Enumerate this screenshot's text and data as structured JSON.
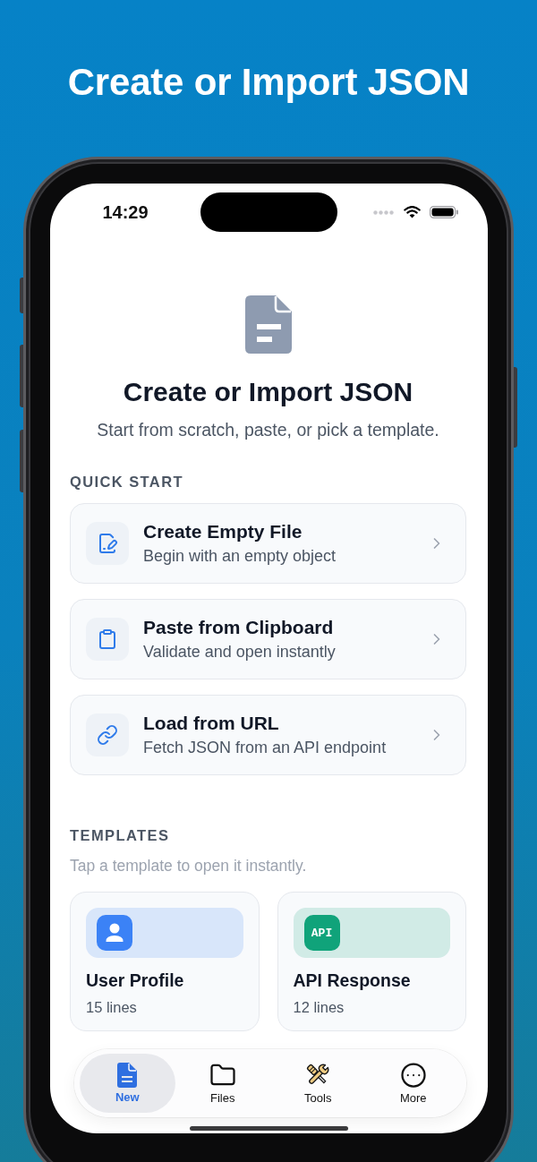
{
  "headline": "Create or Import JSON",
  "status_bar": {
    "time": "14:29"
  },
  "hero": {
    "title": "Create or Import JSON",
    "subtitle": "Start from scratch, paste, or pick a template."
  },
  "quick_start": {
    "heading": "QUICK START",
    "options": [
      {
        "kind": "new-file",
        "title": "Create Empty File",
        "subtitle": "Begin with an empty object"
      },
      {
        "kind": "clipboard",
        "title": "Paste from Clipboard",
        "subtitle": "Validate and open instantly"
      },
      {
        "kind": "link",
        "title": "Load from URL",
        "subtitle": "Fetch JSON from an API endpoint"
      }
    ]
  },
  "templates": {
    "heading": "TEMPLATES",
    "hint": "Tap a template to open it instantly.",
    "items": [
      {
        "kind": "person",
        "title": "User Profile",
        "lines": "15 lines",
        "color": "#3b82f6"
      },
      {
        "kind": "label",
        "label": "API",
        "title": "API Response",
        "lines": "12 lines",
        "color": "#10a37a"
      }
    ]
  },
  "tabs": [
    {
      "kind": "new",
      "label": "New",
      "selected": true
    },
    {
      "kind": "files",
      "label": "Files",
      "selected": false
    },
    {
      "kind": "tools",
      "label": "Tools",
      "selected": false
    },
    {
      "kind": "more",
      "label": "More",
      "selected": false
    }
  ]
}
